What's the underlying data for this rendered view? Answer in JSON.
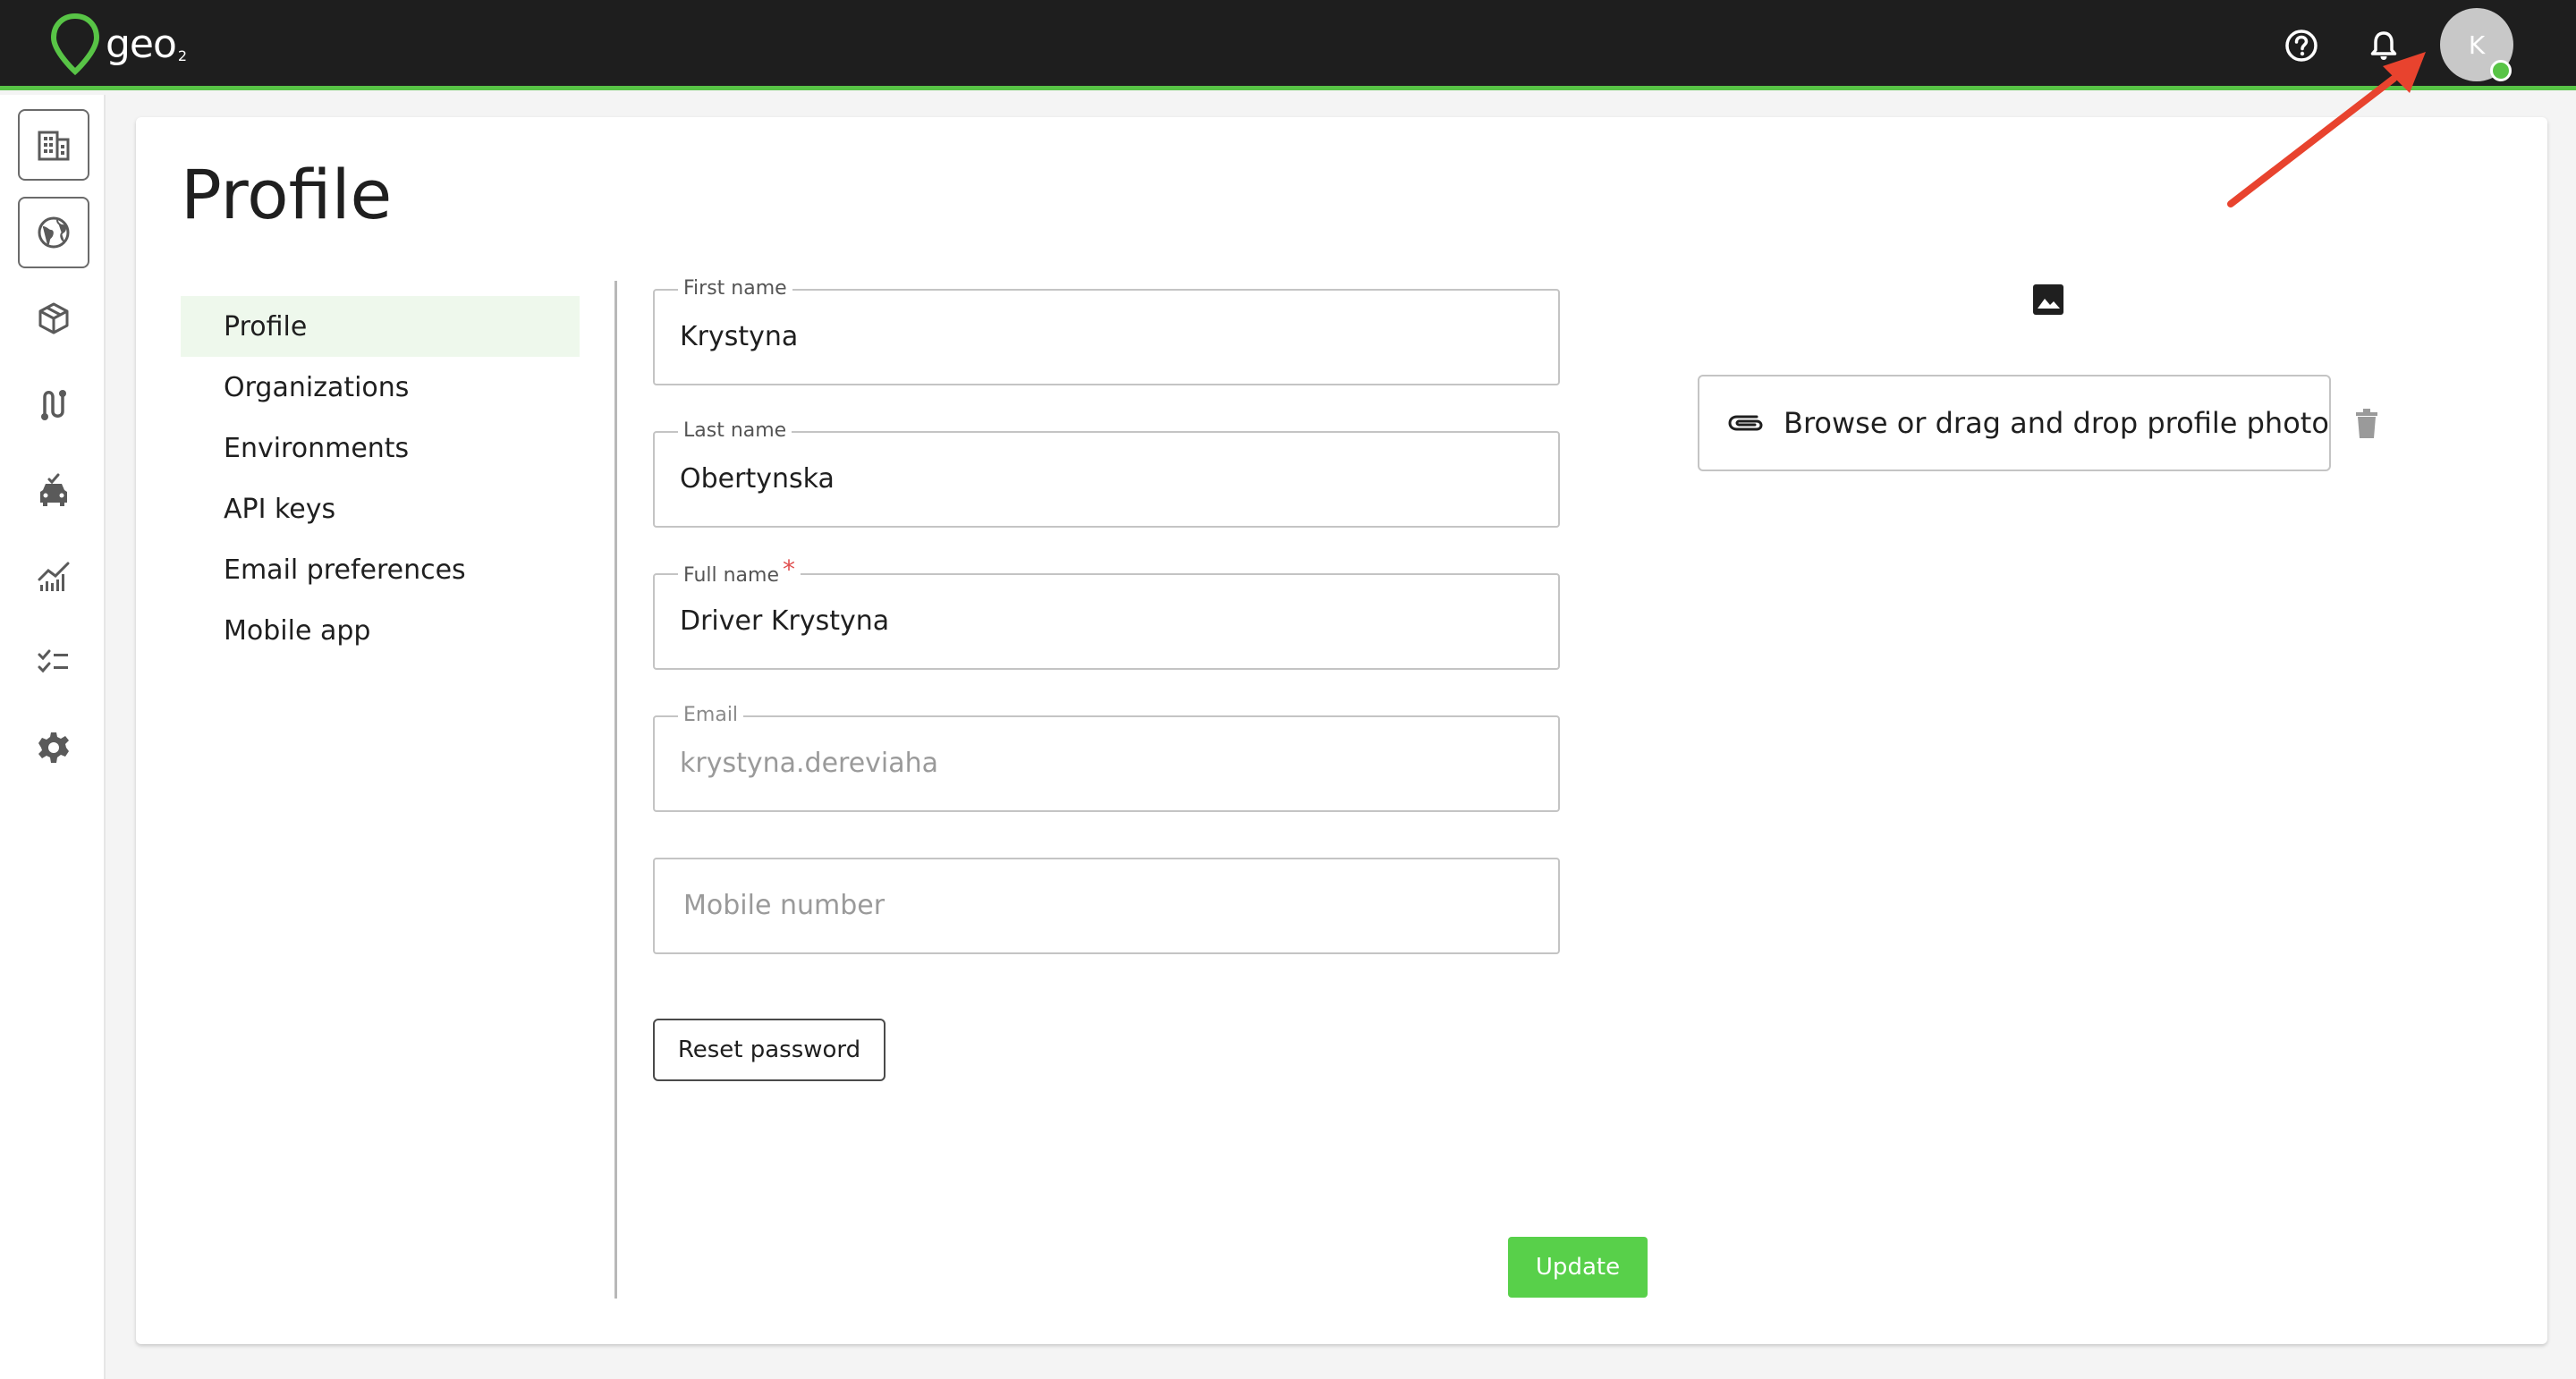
{
  "app": {
    "logo_text": "geo",
    "logo_sub": "2"
  },
  "header": {
    "avatar_initial": "K",
    "icons": [
      "help-icon",
      "bell-icon"
    ],
    "status_color": "#58c446"
  },
  "sidenav": {
    "items": [
      "buildings-icon",
      "globe-icon",
      "box-icon",
      "route-icon",
      "vehicle-icon",
      "analytics-icon",
      "checklist-icon",
      "settings-icon"
    ]
  },
  "page": {
    "title": "Profile"
  },
  "menu": {
    "items": [
      "Profile",
      "Organizations",
      "Environments",
      "API keys",
      "Email preferences",
      "Mobile app"
    ],
    "active": "Profile"
  },
  "form": {
    "first_name": {
      "label": "First name",
      "value": "Krystyna"
    },
    "last_name": {
      "label": "Last name",
      "value": "Obertynska"
    },
    "full_name": {
      "label": "Full name",
      "required_mark": "*",
      "value": "Driver Krystyna"
    },
    "email": {
      "label": "Email",
      "value": "krystyna.dereviaha"
    },
    "mobile": {
      "placeholder": "Mobile number"
    },
    "reset_password_label": "Reset password",
    "update_label": "Update"
  },
  "photo": {
    "browse_label": "Browse or drag and drop profile photo"
  },
  "colors": {
    "accent": "#58c446",
    "update_button": "#58d04a",
    "annotation_arrow": "#e8432e"
  }
}
